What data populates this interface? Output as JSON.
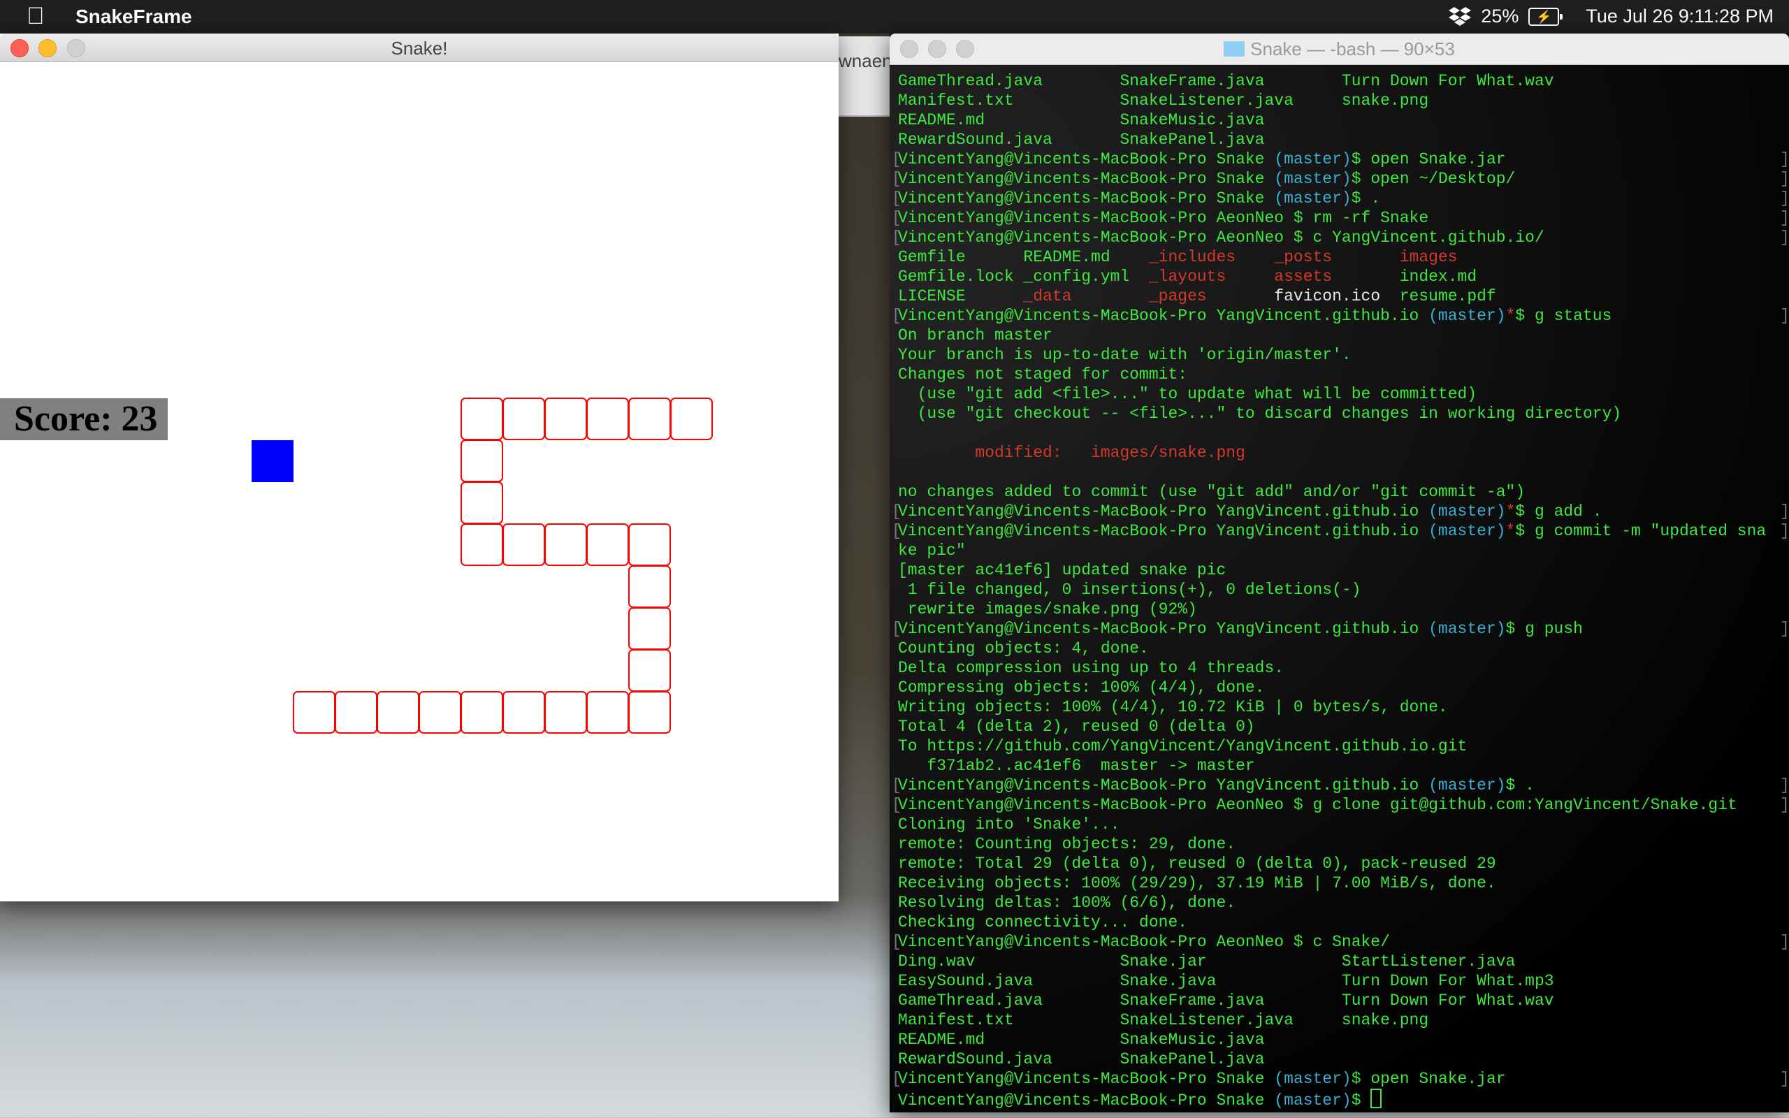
{
  "menubar": {
    "app_name": "SnakeFrame",
    "battery_percent": "25%",
    "datetime": "Tue Jul 26  9:11:28 PM"
  },
  "background_window": {
    "fragment": "wnaenr"
  },
  "snake_window": {
    "title": "Snake!",
    "score_label": "Score: 23",
    "colors": {
      "snake": "#ff0000",
      "food": "#0000ff",
      "score_bg": "#808080"
    }
  },
  "terminal": {
    "title": "Snake — -bash — 90×53",
    "lines": [
      {
        "s": [
          {
            "t": "GameThread.java        SnakeFrame.java        Turn Down For What.wav",
            "c": "g"
          }
        ]
      },
      {
        "s": [
          {
            "t": "Manifest.txt           SnakeListener.java     snake.png",
            "c": "g"
          }
        ]
      },
      {
        "s": [
          {
            "t": "README.md              SnakeMusic.java",
            "c": "g"
          }
        ]
      },
      {
        "s": [
          {
            "t": "RewardSound.java       SnakePanel.java",
            "c": "g"
          }
        ]
      },
      {
        "m": 1,
        "s": [
          {
            "t": "VincentYang@Vincents-MacBook-Pro Snake ",
            "c": "g"
          },
          {
            "t": "(master)",
            "c": "c"
          },
          {
            "t": "$ open Snake.jar",
            "c": "g"
          }
        ]
      },
      {
        "m": 1,
        "s": [
          {
            "t": "VincentYang@Vincents-MacBook-Pro Snake ",
            "c": "g"
          },
          {
            "t": "(master)",
            "c": "c"
          },
          {
            "t": "$ open ~/Desktop/",
            "c": "g"
          }
        ]
      },
      {
        "m": 1,
        "s": [
          {
            "t": "VincentYang@Vincents-MacBook-Pro Snake ",
            "c": "g"
          },
          {
            "t": "(master)",
            "c": "c"
          },
          {
            "t": "$ .",
            "c": "g"
          }
        ]
      },
      {
        "m": 1,
        "s": [
          {
            "t": "VincentYang@Vincents-MacBook-Pro AeonNeo $ rm -rf Snake",
            "c": "g"
          }
        ]
      },
      {
        "m": 1,
        "s": [
          {
            "t": "VincentYang@Vincents-MacBook-Pro AeonNeo $ c YangVincent.github.io/",
            "c": "g"
          }
        ]
      },
      {
        "s": [
          {
            "t": "Gemfile      README.md    ",
            "c": "g"
          },
          {
            "t": "_includes    _posts       images",
            "c": "r"
          }
        ]
      },
      {
        "s": [
          {
            "t": "Gemfile.lock _config.yml  ",
            "c": "g"
          },
          {
            "t": "_layouts     assets       ",
            "c": "r"
          },
          {
            "t": "index.md",
            "c": "g"
          }
        ]
      },
      {
        "s": [
          {
            "t": "LICENSE      ",
            "c": "g"
          },
          {
            "t": "_data        _pages       ",
            "c": "r"
          },
          {
            "t": "favicon.ico  ",
            "c": "w"
          },
          {
            "t": "resume.pdf",
            "c": "g"
          }
        ]
      },
      {
        "m": 1,
        "s": [
          {
            "t": "VincentYang@Vincents-MacBook-Pro YangVincent.github.io ",
            "c": "g"
          },
          {
            "t": "(master)",
            "c": "c"
          },
          {
            "t": "*",
            "c": "r"
          },
          {
            "t": "$ g status",
            "c": "g"
          }
        ]
      },
      {
        "s": [
          {
            "t": "On branch master",
            "c": "g"
          }
        ]
      },
      {
        "s": [
          {
            "t": "Your branch is up-to-date with 'origin/master'.",
            "c": "g"
          }
        ]
      },
      {
        "s": [
          {
            "t": "Changes not staged for commit:",
            "c": "g"
          }
        ]
      },
      {
        "s": [
          {
            "t": "  (use \"git add <file>...\" to update what will be committed)",
            "c": "g"
          }
        ]
      },
      {
        "s": [
          {
            "t": "  (use \"git checkout -- <file>...\" to discard changes in working directory)",
            "c": "g"
          }
        ]
      },
      {
        "s": []
      },
      {
        "s": [
          {
            "t": "        modified:   images/snake.png",
            "c": "r"
          }
        ]
      },
      {
        "s": []
      },
      {
        "s": [
          {
            "t": "no changes added to commit (use \"git add\" and/or \"git commit -a\")",
            "c": "g"
          }
        ]
      },
      {
        "m": 1,
        "s": [
          {
            "t": "VincentYang@Vincents-MacBook-Pro YangVincent.github.io ",
            "c": "g"
          },
          {
            "t": "(master)",
            "c": "c"
          },
          {
            "t": "*",
            "c": "r"
          },
          {
            "t": "$ g add .",
            "c": "g"
          }
        ]
      },
      {
        "m": 1,
        "s": [
          {
            "t": "VincentYang@Vincents-MacBook-Pro YangVincent.github.io ",
            "c": "g"
          },
          {
            "t": "(master)",
            "c": "c"
          },
          {
            "t": "*",
            "c": "r"
          },
          {
            "t": "$ g commit -m \"updated sna",
            "c": "g"
          }
        ]
      },
      {
        "s": [
          {
            "t": "ke pic\"",
            "c": "g"
          }
        ]
      },
      {
        "s": [
          {
            "t": "[master ac41ef6] updated snake pic",
            "c": "g"
          }
        ]
      },
      {
        "s": [
          {
            "t": " 1 file changed, 0 insertions(+), 0 deletions(-)",
            "c": "g"
          }
        ]
      },
      {
        "s": [
          {
            "t": " rewrite images/snake.png (92%)",
            "c": "g"
          }
        ]
      },
      {
        "m": 1,
        "s": [
          {
            "t": "VincentYang@Vincents-MacBook-Pro YangVincent.github.io ",
            "c": "g"
          },
          {
            "t": "(master)",
            "c": "c"
          },
          {
            "t": "$ g push",
            "c": "g"
          }
        ]
      },
      {
        "s": [
          {
            "t": "Counting objects: 4, done.",
            "c": "g"
          }
        ]
      },
      {
        "s": [
          {
            "t": "Delta compression using up to 4 threads.",
            "c": "g"
          }
        ]
      },
      {
        "s": [
          {
            "t": "Compressing objects: 100% (4/4), done.",
            "c": "g"
          }
        ]
      },
      {
        "s": [
          {
            "t": "Writing objects: 100% (4/4), 10.72 KiB | 0 bytes/s, done.",
            "c": "g"
          }
        ]
      },
      {
        "s": [
          {
            "t": "Total 4 (delta 2), reused 0 (delta 0)",
            "c": "g"
          }
        ]
      },
      {
        "s": [
          {
            "t": "To https://github.com/YangVincent/YangVincent.github.io.git",
            "c": "g"
          }
        ]
      },
      {
        "s": [
          {
            "t": "   f371ab2..ac41ef6  master -> master",
            "c": "g"
          }
        ]
      },
      {
        "m": 1,
        "s": [
          {
            "t": "VincentYang@Vincents-MacBook-Pro YangVincent.github.io ",
            "c": "g"
          },
          {
            "t": "(master)",
            "c": "c"
          },
          {
            "t": "$ .",
            "c": "g"
          }
        ]
      },
      {
        "m": 1,
        "s": [
          {
            "t": "VincentYang@Vincents-MacBook-Pro AeonNeo $ g clone git@github.com:YangVincent/Snake.git",
            "c": "g"
          }
        ]
      },
      {
        "s": [
          {
            "t": "Cloning into 'Snake'...",
            "c": "g"
          }
        ]
      },
      {
        "s": [
          {
            "t": "remote: Counting objects: 29, done.",
            "c": "g"
          }
        ]
      },
      {
        "s": [
          {
            "t": "remote: Total 29 (delta 0), reused 0 (delta 0), pack-reused 29",
            "c": "g"
          }
        ]
      },
      {
        "s": [
          {
            "t": "Receiving objects: 100% (29/29), 37.19 MiB | 7.00 MiB/s, done.",
            "c": "g"
          }
        ]
      },
      {
        "s": [
          {
            "t": "Resolving deltas: 100% (6/6), done.",
            "c": "g"
          }
        ]
      },
      {
        "s": [
          {
            "t": "Checking connectivity... done.",
            "c": "g"
          }
        ]
      },
      {
        "m": 1,
        "s": [
          {
            "t": "VincentYang@Vincents-MacBook-Pro AeonNeo $ c Snake/",
            "c": "g"
          }
        ]
      },
      {
        "s": [
          {
            "t": "Ding.wav               Snake.jar              StartListener.java",
            "c": "g"
          }
        ]
      },
      {
        "s": [
          {
            "t": "EasySound.java         Snake.java             Turn Down For What.mp3",
            "c": "g"
          }
        ]
      },
      {
        "s": [
          {
            "t": "GameThread.java        SnakeFrame.java        Turn Down For What.wav",
            "c": "g"
          }
        ]
      },
      {
        "s": [
          {
            "t": "Manifest.txt           SnakeListener.java     snake.png",
            "c": "g"
          }
        ]
      },
      {
        "s": [
          {
            "t": "README.md              SnakeMusic.java",
            "c": "g"
          }
        ]
      },
      {
        "s": [
          {
            "t": "RewardSound.java       SnakePanel.java",
            "c": "g"
          }
        ]
      },
      {
        "m": 1,
        "s": [
          {
            "t": "VincentYang@Vincents-MacBook-Pro Snake ",
            "c": "g"
          },
          {
            "t": "(master)",
            "c": "c"
          },
          {
            "t": "$ open Snake.jar",
            "c": "g"
          }
        ]
      },
      {
        "cursor": 1,
        "s": [
          {
            "t": "VincentYang@Vincents-MacBook-Pro Snake ",
            "c": "g"
          },
          {
            "t": "(master)",
            "c": "c"
          },
          {
            "t": "$ ",
            "c": "g"
          }
        ]
      }
    ]
  }
}
